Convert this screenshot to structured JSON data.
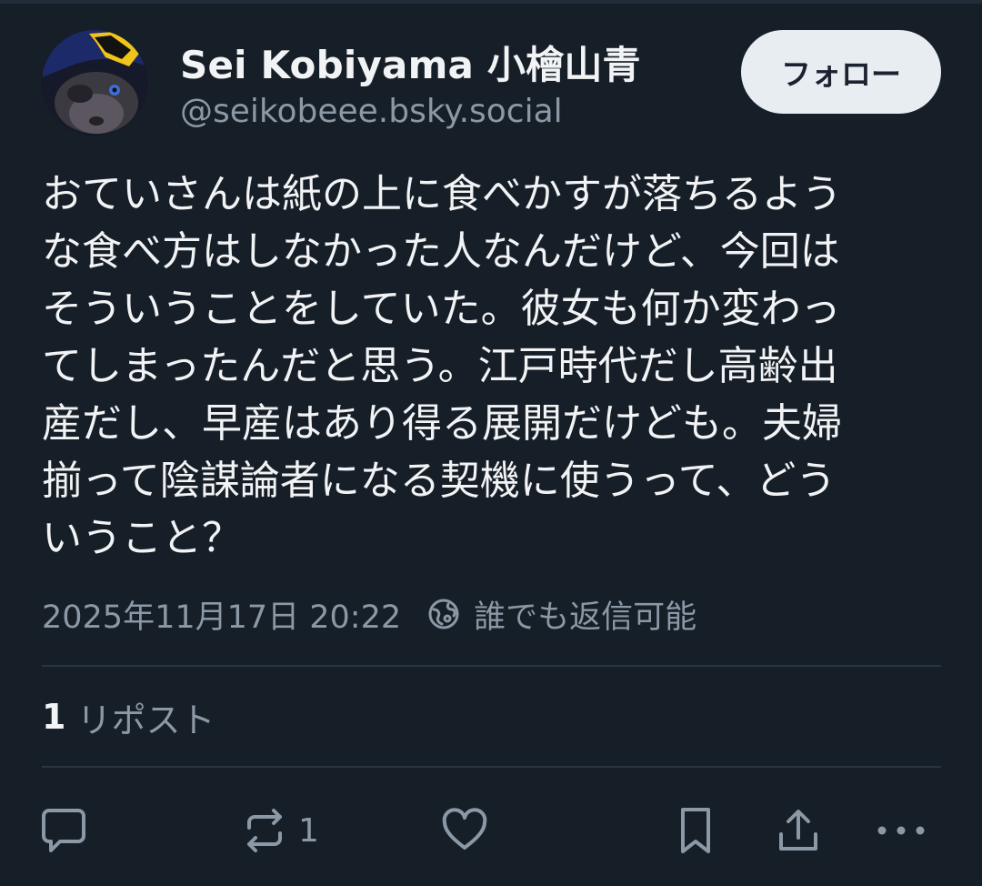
{
  "author": {
    "display_name": "Sei Kobiyama 小檜山青",
    "handle": "@seikobeee.bsky.social"
  },
  "follow_button": {
    "label": "フォロー"
  },
  "post": {
    "text_lines": [
      "おていさんは紙の上に食べかすが落ちるよう",
      "な食べ方はしなかった人なんだけど、今回は",
      "そういうことをしていた。彼女も何か変わっ",
      "てしまったんだと思う。江戸時代だし高齢出",
      "産だし、早産はあり得る展開だけども。夫婦",
      "揃って陰謀論者になる契機に使うって、どう",
      "いうこと？"
    ],
    "timestamp": "2025年11月17日 20:22",
    "reply_setting": "誰でも返信可能"
  },
  "stats": {
    "repost_count": "1",
    "repost_label": "リポスト"
  },
  "actions": {
    "reply": {
      "icon": "reply-icon"
    },
    "repost": {
      "icon": "repost-icon",
      "count": "1"
    },
    "like": {
      "icon": "heart-icon"
    },
    "bookmark": {
      "icon": "bookmark-icon"
    },
    "share": {
      "icon": "share-icon"
    },
    "more": {
      "icon": "more-icon"
    }
  },
  "colors": {
    "background": "#161e27",
    "text_primary": "#f1f3f5",
    "text_secondary": "#8b98a5",
    "follow_button_bg": "#e8edf2",
    "divider": "#2a3542"
  }
}
